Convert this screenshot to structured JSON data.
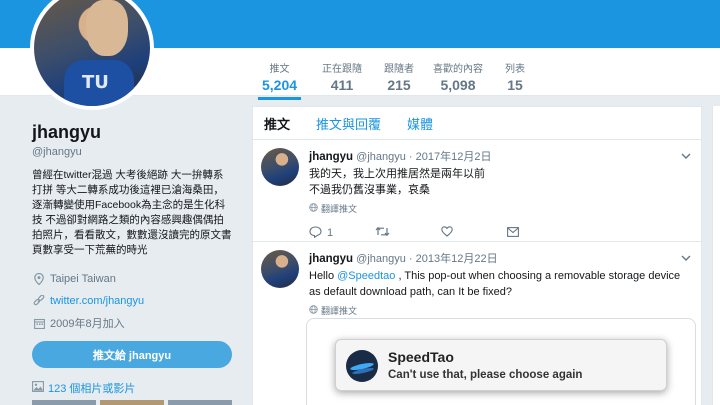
{
  "profile": {
    "name": "jhangyu",
    "handle": "@jhangyu",
    "bio": "曾經在twitter混過 大考後絕跡 大一拚轉系打拼 等大二轉系成功後這裡已滄海桑田，逐漸轉變使用Facebook為主念的是生化科技 不過卻對網路之類的內容感興趣偶偶拍拍照片，看看散文，數數還沒讀完的原文書頁數享受一下荒蕪的時光",
    "location": "Taipei Taiwan",
    "website": "twitter.com/jhangyu",
    "joined": "2009年8月加入",
    "tweet_to_button": "推文給 jhangyu",
    "photos_link": "123 個相片或影片"
  },
  "stats": [
    {
      "label": "推文",
      "value": "5,204"
    },
    {
      "label": "正在跟隨",
      "value": "411"
    },
    {
      "label": "跟隨者",
      "value": "215"
    },
    {
      "label": "喜歡的內容",
      "value": "5,098"
    },
    {
      "label": "列表",
      "value": "15"
    }
  ],
  "tabs": [
    "推文",
    "推文與回覆",
    "媒體"
  ],
  "tweets": [
    {
      "name": "jhangyu",
      "handle": "@jhangyu",
      "date": "· 2017年12月2日",
      "line1": "我的天，我上次用推居然是兩年以前",
      "line2": "不過我仍舊沒事業，哀桑",
      "translate": "翻譯推文",
      "reply_count": "1"
    },
    {
      "name": "jhangyu",
      "handle": "@jhangyu",
      "date": "· 2013年12月22日",
      "text_pre": "Hello ",
      "mention": "@Speedtao",
      "text_post": " , This pop-out when choosing a removable storage device as default download path, can It be fixed?",
      "translate": "翻譯推文"
    }
  ],
  "popup": {
    "title": "SpeedTao",
    "message": "Can't use that, please choose again"
  },
  "icons": {
    "location": "location-pin-icon",
    "link": "link-icon",
    "calendar": "calendar-icon",
    "photo": "photo-icon",
    "globe": "globe-icon",
    "reply": "reply-icon",
    "retweet": "retweet-icon",
    "like": "heart-icon",
    "dm": "envelope-icon",
    "chevron": "chevron-down-icon"
  },
  "colors": {
    "brand": "#1b95e0",
    "banner": "#1b95e0",
    "button": "#4aa8e0",
    "background": "#e6ecf0"
  }
}
